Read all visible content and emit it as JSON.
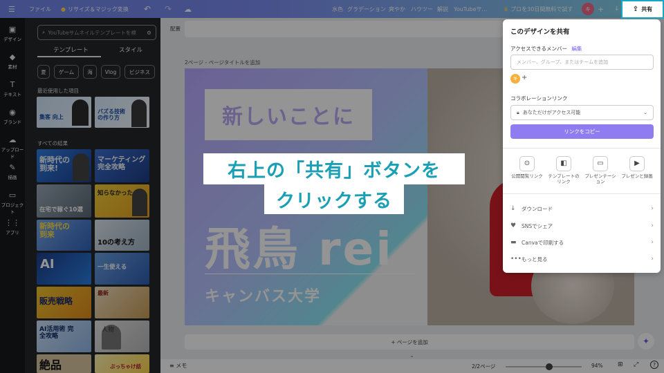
{
  "topbar": {
    "menu": "☰",
    "file": "ファイル",
    "resize": "リサイズ＆マジック変換",
    "undo": "↶",
    "redo": "↷",
    "cloud": "☁",
    "items": [
      "水色",
      "グラデーション",
      "爽やか",
      "ハウツー",
      "解説",
      "YouTubeサ..."
    ],
    "pro_trial": "プロを30日間無料で試す",
    "avatar": "キ",
    "plus": "+",
    "share": "共有"
  },
  "rail": {
    "items": [
      {
        "icon": "▣",
        "label": "デザイン"
      },
      {
        "icon": "◆",
        "label": "素材"
      },
      {
        "icon": "T",
        "label": "テキスト"
      },
      {
        "icon": "◉",
        "label": "ブランド"
      },
      {
        "icon": "☁",
        "label": "アップロード"
      },
      {
        "icon": "✎",
        "label": "描画"
      },
      {
        "icon": "▭",
        "label": "プロジェクト"
      },
      {
        "icon": "⋮⋮",
        "label": "アプリ"
      }
    ]
  },
  "panel": {
    "search_placeholder": "YouTubeサムネイルテンプレートを検",
    "tabs": [
      "テンプレート",
      "スタイル"
    ],
    "chips": [
      "夏",
      "ゲーム",
      "海",
      "Vlog",
      "ビジネス"
    ],
    "recent_heading": "最近使用した項目",
    "all_heading": "すべての結果"
  },
  "thumbs": {
    "r1": [
      "集客 向上",
      "バズる技術の作り方"
    ],
    "t1": [
      "新時代の到来!",
      "マーケティング完全攻略"
    ],
    "t2": [
      "在宅で稼ぐ10選",
      "知らなかった"
    ],
    "t3": [
      "新時代の到来",
      "10の考え方"
    ],
    "t4": [
      "AI",
      "一生使える"
    ],
    "t5": [
      "販売戦略",
      "最新"
    ],
    "t6": [
      "AI活用術 完全攻略",
      "人物"
    ],
    "t7": [
      "絶品",
      "ぶっちゃけ話"
    ]
  },
  "canvas": {
    "notes_label": "配置",
    "page_label": "2ページ - ページタイトルを追加",
    "title_top": "新しいことに",
    "title_main": "飛鳥 rei",
    "subtitle": "キャンバス大学",
    "add_page": "+ ページを追加"
  },
  "bottombar": {
    "memo": "メモ",
    "pages": "2/2ページ",
    "zoom": "94%",
    "zoom_level": 0.57
  },
  "share_panel": {
    "title": "このデザインを共有",
    "members_label": "アクセスできるメンバー",
    "edit_link": "編集",
    "members_placeholder": "メンバー、グループ、またはチームを追加",
    "collab_label": "コラボレーションリンク",
    "access_value": "あなただけがアクセス可能",
    "copy_button": "リンクをコピー",
    "options": [
      {
        "icon": "⊙",
        "label": "公開閲覧リンク"
      },
      {
        "icon": "◧",
        "label": "テンプレートのリンク"
      },
      {
        "icon": "▭",
        "label": "プレゼンテーション"
      },
      {
        "icon": "▶",
        "label": "プレゼンと録画"
      }
    ],
    "rows": [
      {
        "icon": "↓",
        "label": "ダウンロード"
      },
      {
        "icon": "♥",
        "label": "SNSでシェア"
      },
      {
        "icon": "▬",
        "label": "Canvaで印刷する"
      },
      {
        "icon": "•••",
        "label": "もっと見る"
      }
    ]
  },
  "caption": {
    "line1": "右上の「共有」ボタンを",
    "line2": "クリックする"
  },
  "colors": {
    "accent_teal": "#14a8c2",
    "purple": "#8e7cf0",
    "caption_text": "#1a9fb5"
  }
}
